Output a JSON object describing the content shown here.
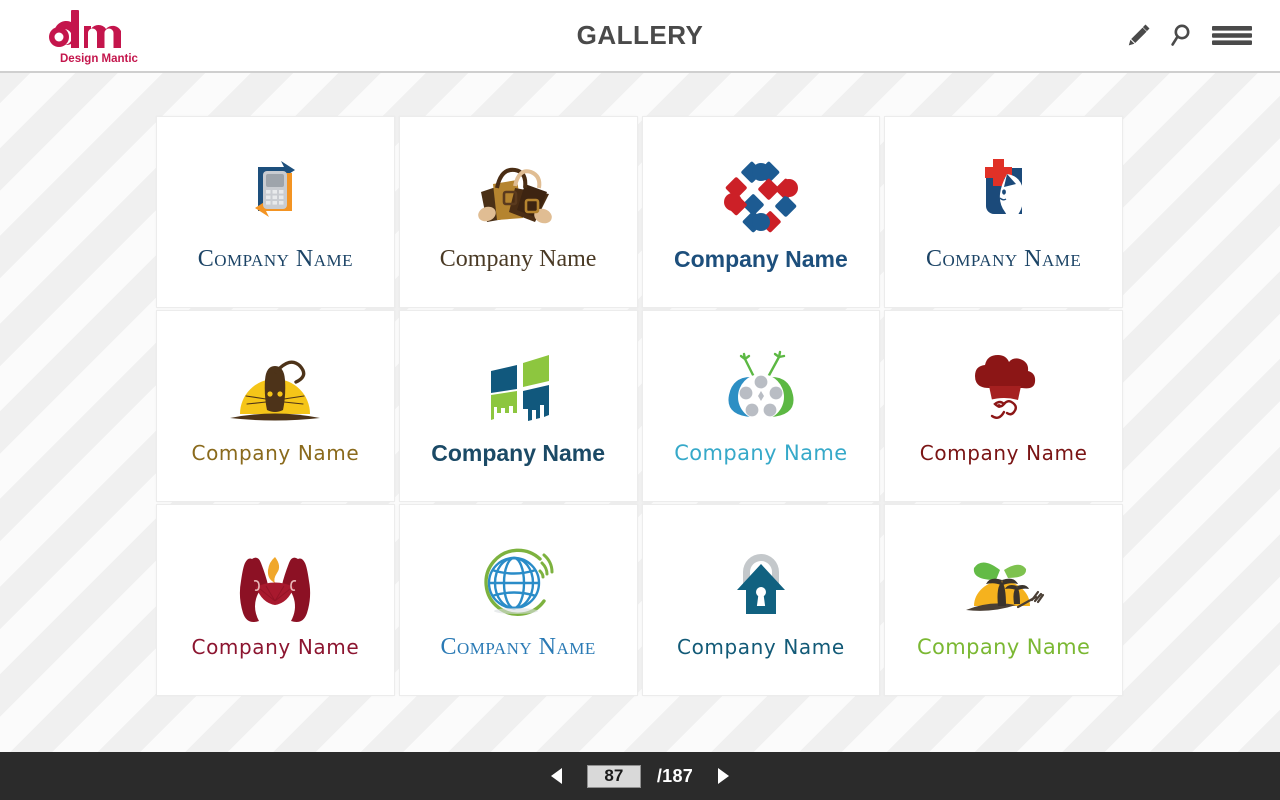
{
  "header": {
    "title": "GALLERY",
    "brand": {
      "mark": "dm",
      "name": "Design Mantic",
      "color": "#c4154c"
    },
    "actions": [
      {
        "name": "edit-icon",
        "label": "Edit"
      },
      {
        "name": "search-icon",
        "label": "Search"
      },
      {
        "name": "menu-icon",
        "label": "Menu"
      }
    ]
  },
  "gallery": {
    "cards": [
      {
        "id": "mobile-sync-logo",
        "art": "mobile-sync-icon",
        "label": "Company Name",
        "text_style": "t-serif-caps",
        "text_color": "#1c4466",
        "colors": {
          "primary": "#1d4f7c",
          "secondary": "#f39423",
          "tertiary": "#c9ccd1"
        }
      },
      {
        "id": "handbags-logo",
        "art": "handbags-icon",
        "label": "Company Name",
        "text_style": "t-serif",
        "text_color": "#4a3a25",
        "colors": {
          "primary": "#5a3a1e",
          "secondary": "#b5842f",
          "tertiary": "#e0bd93"
        }
      },
      {
        "id": "diamond-weave-logo",
        "art": "diamond-weave-icon",
        "label": "Company Name",
        "text_style": "t-sans-bold",
        "text_color": "#1d4f7c",
        "colors": {
          "primary": "#1d5b92",
          "secondary": "#cc2027"
        }
      },
      {
        "id": "vet-cat-cross-logo",
        "art": "vet-cat-cross-icon",
        "label": "Company Name",
        "text_style": "t-serif-caps",
        "text_color": "#1c4466",
        "colors": {
          "primary": "#1b4a7a",
          "secondary": "#e03127"
        }
      },
      {
        "id": "cat-sunset-logo",
        "art": "cat-sunset-icon",
        "label": "Company Name",
        "text_style": "t-round",
        "text_color": "#8a6a1c",
        "colors": {
          "primary": "#f5c518",
          "secondary": "#4d3319"
        }
      },
      {
        "id": "window-panes-logo",
        "art": "window-panes-icon",
        "label": "Company Name",
        "text_style": "t-sans-bold",
        "text_color": "#1b4a66",
        "colors": {
          "primary": "#11587d",
          "secondary": "#8dc63f"
        }
      },
      {
        "id": "tv-reel-logo",
        "art": "tv-reel-icon",
        "label": "Company Name",
        "text_style": "t-round-light",
        "text_color": "#36a9c9",
        "colors": {
          "primary": "#2d8fc4",
          "secondary": "#5cb843",
          "tertiary": "#b9bdc4"
        }
      },
      {
        "id": "chef-logo",
        "art": "chef-icon",
        "label": "Company Name",
        "text_style": "t-round",
        "text_color": "#7a1414",
        "colors": {
          "primary": "#8c1616"
        }
      },
      {
        "id": "hands-flame-logo",
        "art": "hands-flame-icon",
        "label": "Company Name",
        "text_style": "t-round",
        "text_color": "#8c1530",
        "colors": {
          "primary": "#8c1124",
          "secondary": "#f0a72a"
        }
      },
      {
        "id": "globe-signal-logo",
        "art": "globe-signal-icon",
        "label": "Company Name",
        "text_style": "t-serif-caps",
        "text_color": "#2a7ab5",
        "colors": {
          "primary": "#2a8cc8",
          "secondary": "#7db23f"
        }
      },
      {
        "id": "house-lock-logo",
        "art": "house-lock-icon",
        "label": "Company Name",
        "text_style": "t-round",
        "text_color": "#125a77",
        "colors": {
          "primary": "#116180",
          "secondary": "#c4c8cb"
        }
      },
      {
        "id": "tropical-fork-logo",
        "art": "tropical-fork-icon",
        "label": "Company Name",
        "text_style": "t-round-light",
        "text_color": "#7bb833",
        "colors": {
          "primary": "#f5b21e",
          "secondary": "#63bb46",
          "tertiary": "#4a3f35"
        }
      }
    ]
  },
  "pagination": {
    "prev_label": "Previous page",
    "next_label": "Next page",
    "current_page": "87",
    "total_pages": "/187"
  }
}
